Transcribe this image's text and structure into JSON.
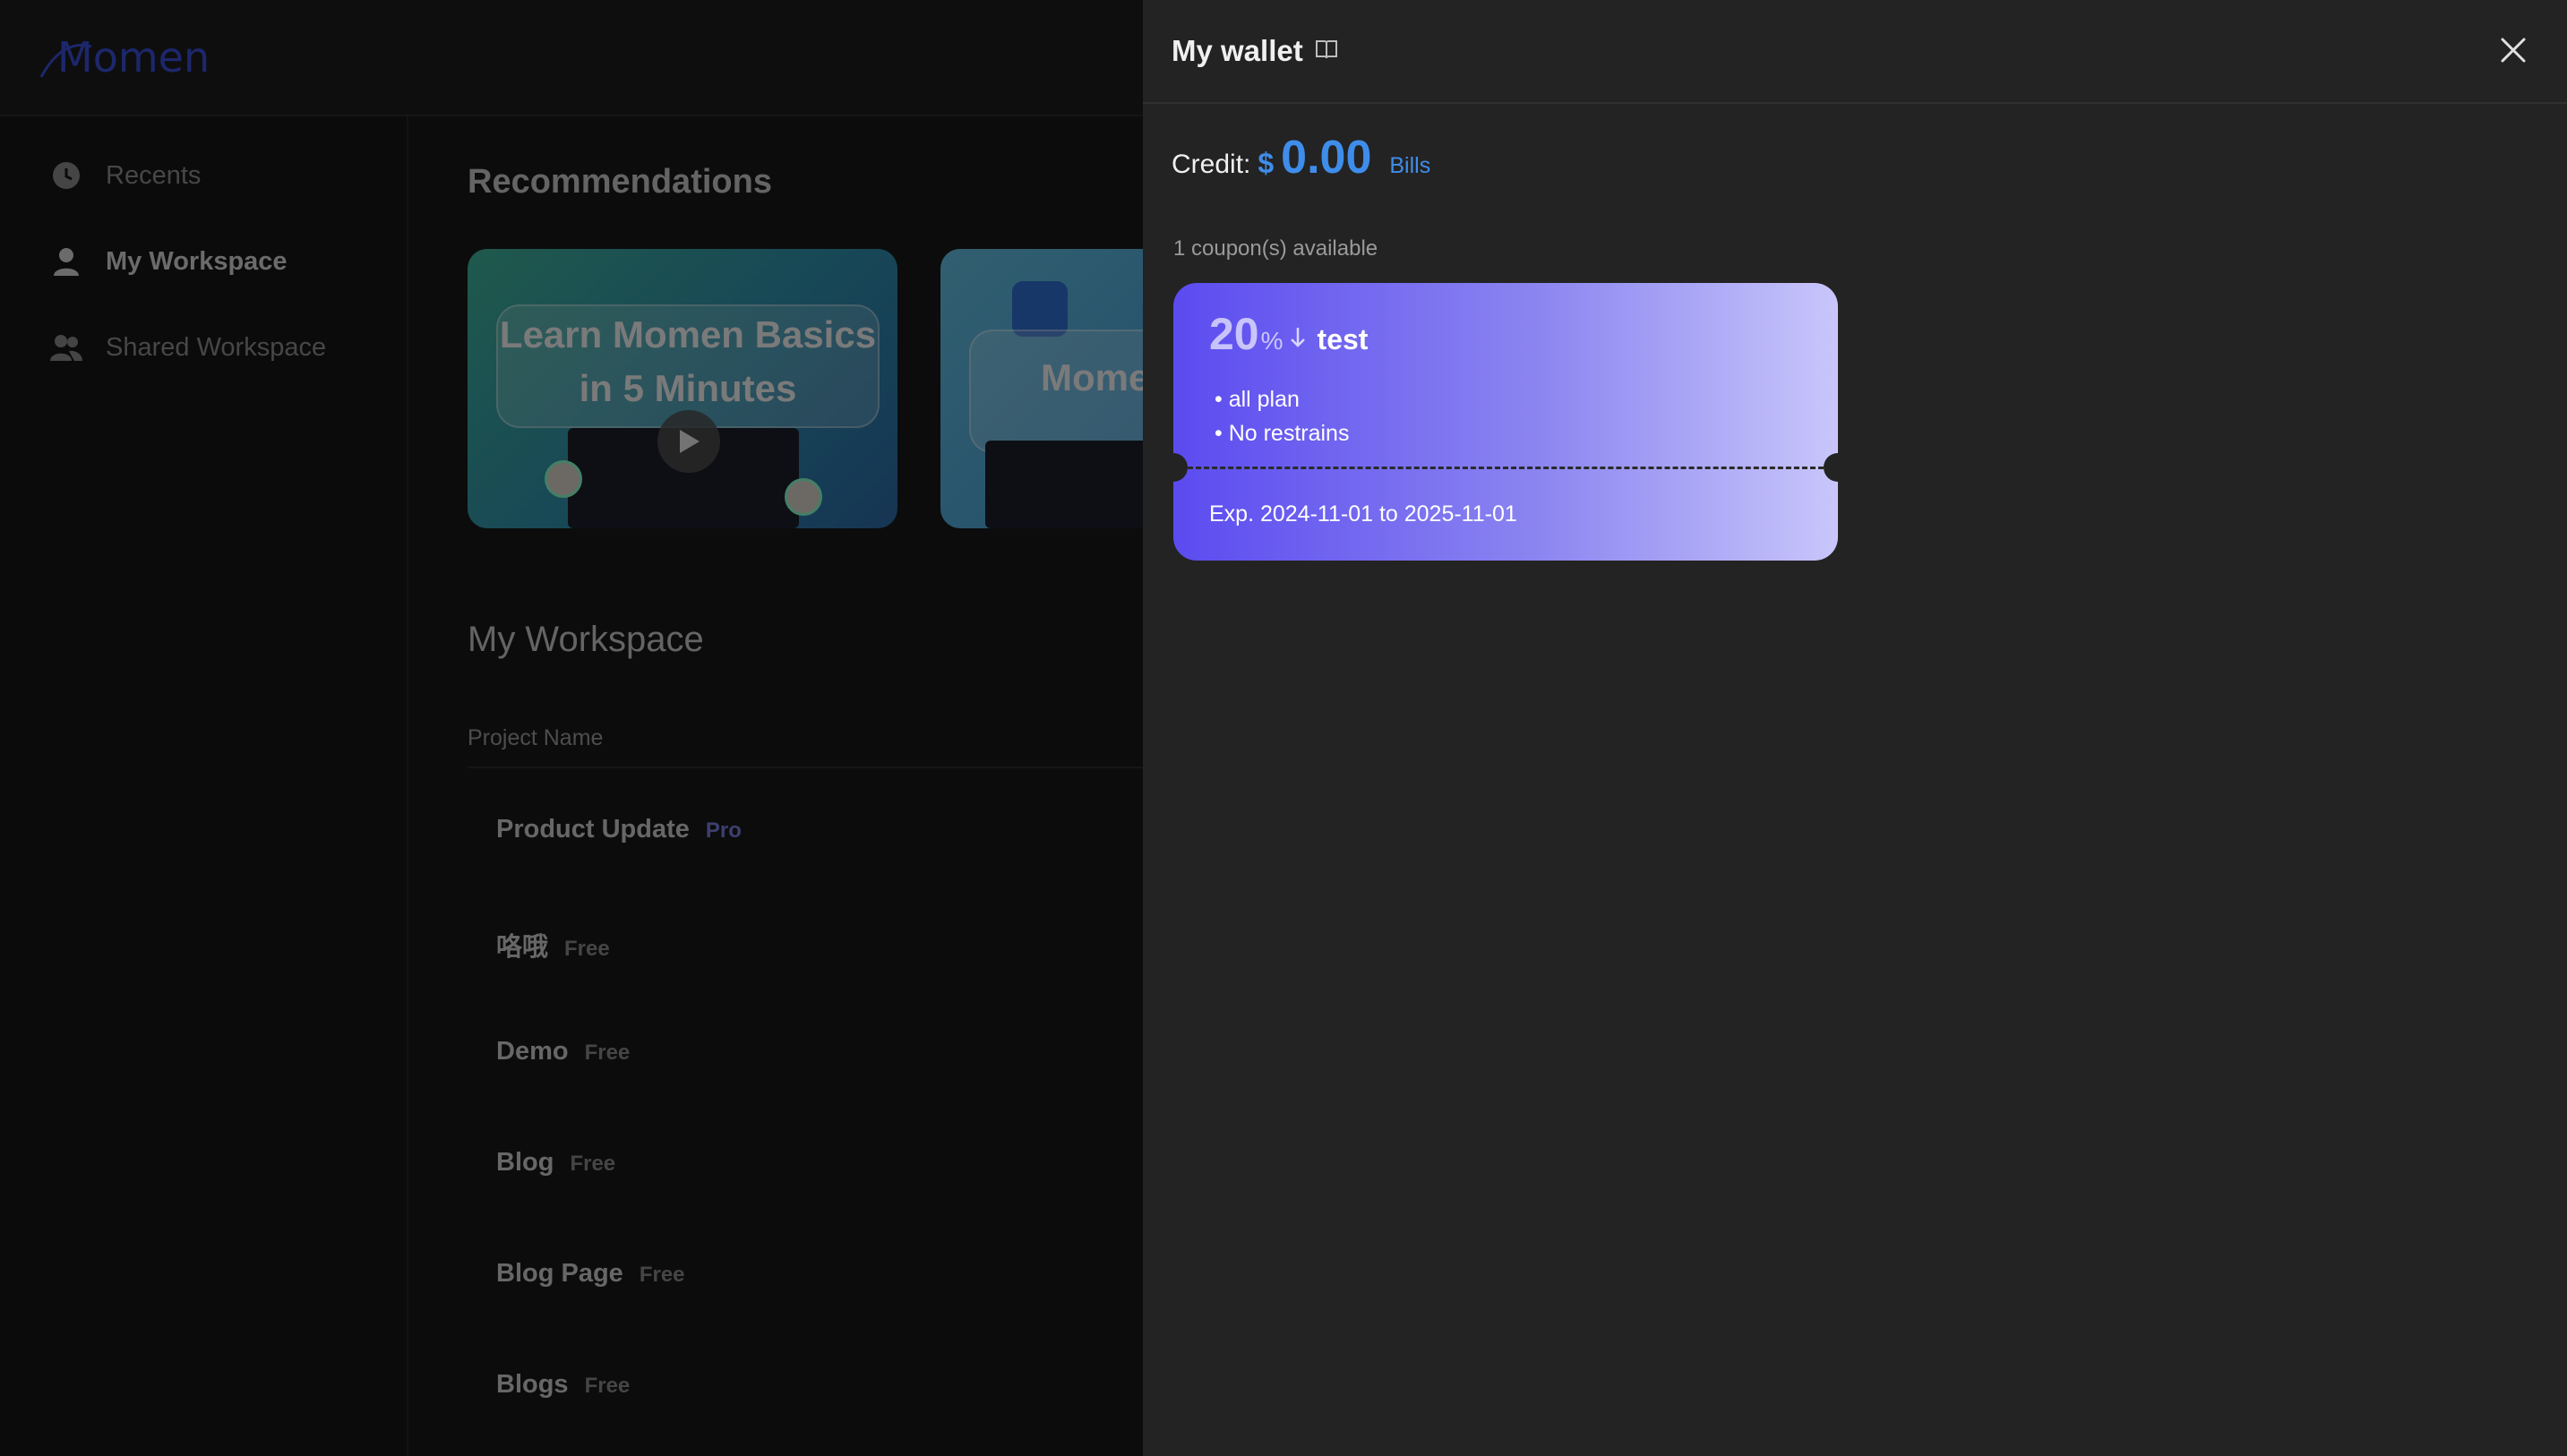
{
  "logo": {
    "text": "Momen"
  },
  "sidebar": {
    "items": [
      {
        "label": "Recents",
        "icon": "clock-icon"
      },
      {
        "label": "My Workspace",
        "icon": "user-icon",
        "active": true
      },
      {
        "label": "Shared Workspace",
        "icon": "users-icon"
      }
    ]
  },
  "main": {
    "recommendations_title": "Recommendations",
    "cards": [
      {
        "title_line1": "Learn Momen Basics",
        "title_line2": "in 5 Minutes"
      },
      {
        "title_line1": "Mome",
        "title_line2": ""
      }
    ],
    "workspace_title": "My Workspace",
    "column_header": "Project Name",
    "projects": [
      {
        "name": "Product Update",
        "tag": "Pro"
      },
      {
        "name": "咯哦",
        "tag": "Free"
      },
      {
        "name": "Demo",
        "tag": "Free"
      },
      {
        "name": "Blog",
        "tag": "Free"
      },
      {
        "name": "Blog Page",
        "tag": "Free"
      },
      {
        "name": "Blogs",
        "tag": "Free"
      }
    ]
  },
  "wallet": {
    "title": "My wallet",
    "credit_label": "Credit:",
    "currency": "$",
    "credit_value": "0.00",
    "bills_label": "Bills",
    "coupons_count": "1 coupon(s) available",
    "coupons": [
      {
        "discount": "20",
        "unit": "%",
        "name": "test",
        "lines": [
          "• all plan",
          "• No restrains"
        ],
        "expiry": "Exp. 2024-11-01 to 2025-11-01"
      }
    ]
  },
  "colors": {
    "accent": "#3f8dea",
    "coupon_start": "#5b4bf0",
    "coupon_end": "#c8c6fb",
    "pro_tag": "#7b7fe0"
  }
}
